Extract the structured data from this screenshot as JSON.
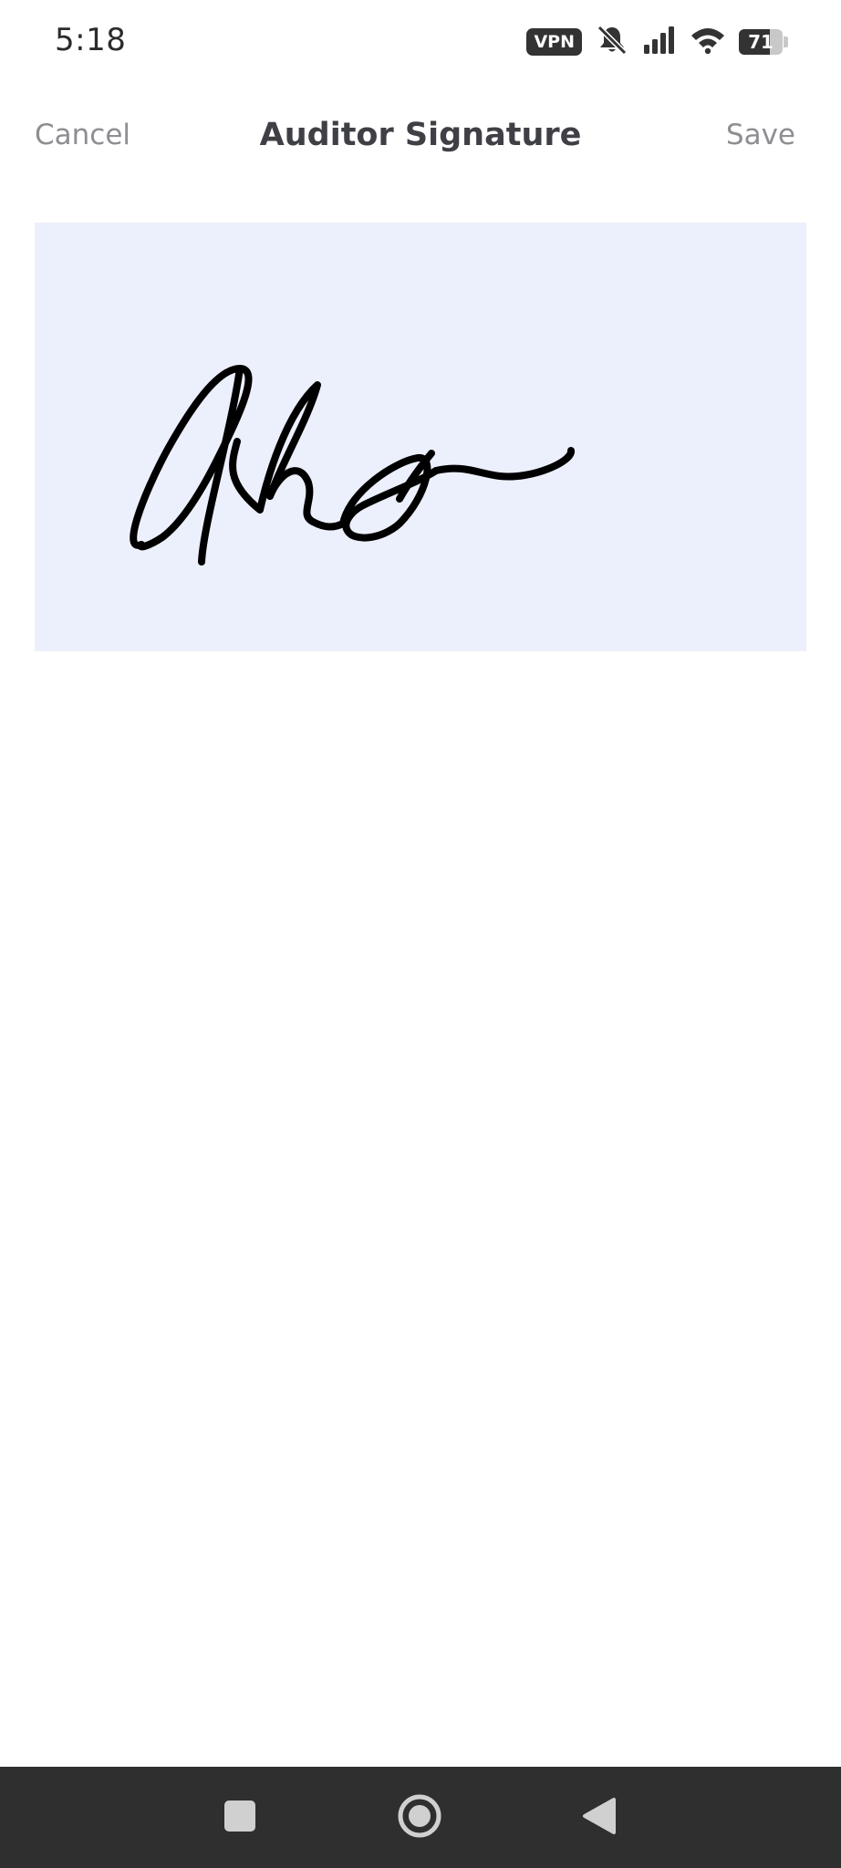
{
  "status_bar": {
    "time": "5:18",
    "vpn_label": "VPN",
    "battery_level": "71",
    "battery_fraction": 0.71,
    "icons": [
      "vpn-icon",
      "bell-muted-icon",
      "signal-icon",
      "wifi-icon",
      "battery-icon"
    ]
  },
  "header": {
    "cancel_label": "Cancel",
    "title": "Auditor Signature",
    "save_label": "Save"
  },
  "signature_pad": {
    "background_color": "#ecf0fc",
    "stroke_color": "#000000"
  },
  "nav_bar": {
    "buttons": [
      "recents-square-icon",
      "home-circle-icon",
      "back-triangle-icon"
    ],
    "background_color": "#2f2f2f"
  },
  "colors": {
    "title": "#3f3f46",
    "secondary_text": "#8e8e93"
  }
}
